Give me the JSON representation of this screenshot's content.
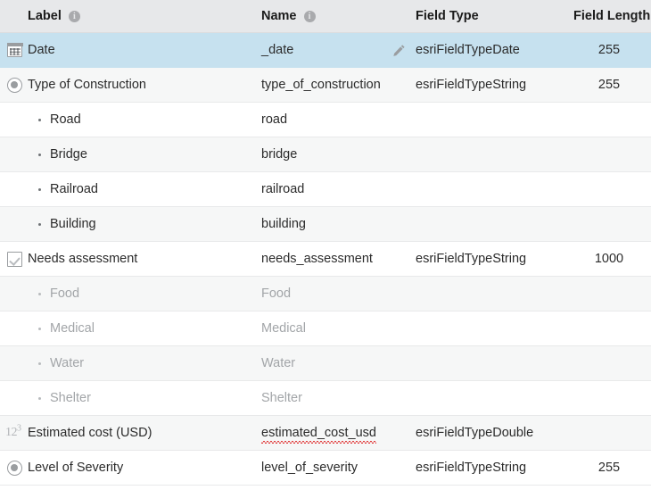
{
  "header": {
    "columns": [
      {
        "key": "label",
        "label": "Label",
        "info_icon": "info-icon",
        "has_info": true
      },
      {
        "key": "name",
        "label": "Name",
        "info_icon": "info-icon",
        "has_info": true
      },
      {
        "key": "field_type",
        "label": "Field Type",
        "has_info": false
      },
      {
        "key": "field_length",
        "label": "Field Length",
        "has_info": false
      }
    ],
    "info_glyph": "i"
  },
  "colors": {
    "header_bg": "#e7e8ea",
    "selected_row_bg": "#c6e1ef",
    "alt_row_bg": "#f6f7f7",
    "row_bg": "#ffffff",
    "row_divider": "#e8e9ea",
    "text": "#2b2b2b",
    "muted_text": "#a2a5a8",
    "icon": "#9a9da0",
    "spellcheck_underline": "#e03030"
  },
  "rows": [
    {
      "label": "Date",
      "name": "_date",
      "field_type": "esriFieldTypeDate",
      "field_length": "255",
      "icon": "calendar-icon",
      "child": false,
      "muted": false,
      "selected": true,
      "striped": false,
      "edit_icon": "pencil-icon",
      "spellcheck": false
    },
    {
      "label": "Type of Construction",
      "name": "type_of_construction",
      "field_type": "esriFieldTypeString",
      "field_length": "255",
      "icon": "radio-button-icon",
      "child": false,
      "muted": false,
      "selected": false,
      "striped": true,
      "edit_icon": "",
      "spellcheck": false
    },
    {
      "label": "Road",
      "name": "road",
      "field_type": "",
      "field_length": "",
      "icon": "",
      "child": true,
      "muted": false,
      "selected": false,
      "striped": false,
      "edit_icon": "",
      "spellcheck": false
    },
    {
      "label": "Bridge",
      "name": "bridge",
      "field_type": "",
      "field_length": "",
      "icon": "",
      "child": true,
      "muted": false,
      "selected": false,
      "striped": true,
      "edit_icon": "",
      "spellcheck": false
    },
    {
      "label": "Railroad",
      "name": "railroad",
      "field_type": "",
      "field_length": "",
      "icon": "",
      "child": true,
      "muted": false,
      "selected": false,
      "striped": false,
      "edit_icon": "",
      "spellcheck": false
    },
    {
      "label": "Building",
      "name": "building",
      "field_type": "",
      "field_length": "",
      "icon": "",
      "child": true,
      "muted": false,
      "selected": false,
      "striped": true,
      "edit_icon": "",
      "spellcheck": false
    },
    {
      "label": "Needs assessment",
      "name": "needs_assessment",
      "field_type": "esriFieldTypeString",
      "field_length": "1000",
      "icon": "checkbox-icon",
      "child": false,
      "muted": false,
      "selected": false,
      "striped": false,
      "edit_icon": "",
      "spellcheck": false
    },
    {
      "label": "Food",
      "name": "Food",
      "field_type": "",
      "field_length": "",
      "icon": "",
      "child": true,
      "muted": true,
      "selected": false,
      "striped": true,
      "edit_icon": "",
      "spellcheck": false
    },
    {
      "label": "Medical",
      "name": "Medical",
      "field_type": "",
      "field_length": "",
      "icon": "",
      "child": true,
      "muted": true,
      "selected": false,
      "striped": false,
      "edit_icon": "",
      "spellcheck": false
    },
    {
      "label": "Water",
      "name": "Water",
      "field_type": "",
      "field_length": "",
      "icon": "",
      "child": true,
      "muted": true,
      "selected": false,
      "striped": true,
      "edit_icon": "",
      "spellcheck": false
    },
    {
      "label": "Shelter",
      "name": "Shelter",
      "field_type": "",
      "field_length": "",
      "icon": "",
      "child": true,
      "muted": true,
      "selected": false,
      "striped": false,
      "edit_icon": "",
      "spellcheck": false
    },
    {
      "label": "Estimated cost (USD)",
      "name": "estimated_cost_usd",
      "field_type": "esriFieldTypeDouble",
      "field_length": "",
      "icon": "number-123-icon",
      "child": false,
      "muted": false,
      "selected": false,
      "striped": true,
      "edit_icon": "",
      "spellcheck": true
    },
    {
      "label": "Level of Severity",
      "name": "level_of_severity",
      "field_type": "esriFieldTypeString",
      "field_length": "255",
      "icon": "radio-button-icon",
      "child": false,
      "muted": false,
      "selected": false,
      "striped": false,
      "edit_icon": "",
      "spellcheck": false
    }
  ]
}
